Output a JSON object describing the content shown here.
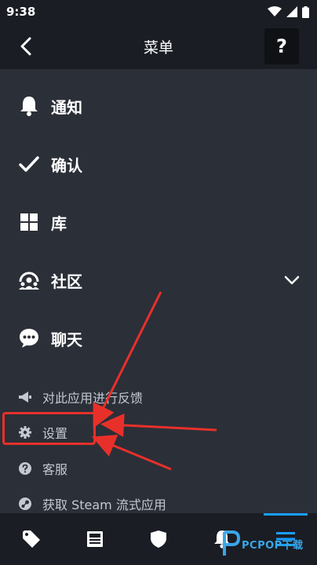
{
  "status_bar": {
    "time": "9:38"
  },
  "header": {
    "title": "菜单",
    "help_label": "?"
  },
  "menu": [
    {
      "label": "通知",
      "icon": "bell-icon"
    },
    {
      "label": "确认",
      "icon": "checkmark-icon"
    },
    {
      "label": "库",
      "icon": "grid-icon"
    },
    {
      "label": "社区",
      "icon": "community-icon",
      "expandable": true
    },
    {
      "label": "聊天",
      "icon": "chat-icon"
    }
  ],
  "sub_menu": [
    {
      "label": "对此应用进行反馈",
      "icon": "megaphone-icon"
    },
    {
      "label": "设置",
      "icon": "gear-icon"
    },
    {
      "label": "客服",
      "icon": "question-icon"
    },
    {
      "label": "获取 Steam 流式应用",
      "icon": "steam-icon"
    }
  ],
  "bottom_nav": [
    {
      "icon": "tag-icon"
    },
    {
      "icon": "news-icon"
    },
    {
      "icon": "shield-icon"
    },
    {
      "icon": "notifications-icon"
    },
    {
      "icon": "menu-icon",
      "active": true
    }
  ],
  "watermark": {
    "text": "PCPOP下载"
  },
  "colors": {
    "background": "#2b2f38",
    "bar": "#1a1d23",
    "accent": "#1a9fff",
    "annotation": "#e8302a"
  }
}
